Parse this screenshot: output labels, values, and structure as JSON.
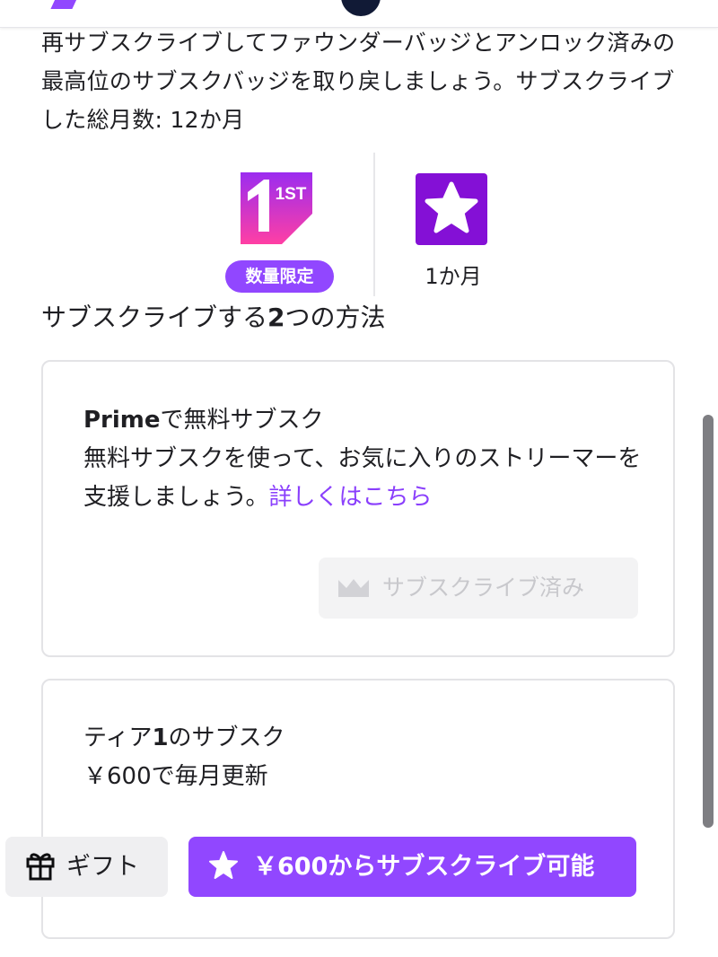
{
  "intro": {
    "text": "再サブスクライブしてファウンダーバッジとアンロック済みの最高位のサブスクバッジを取り戻しましょう。サブスクライブした総月数: 12か月"
  },
  "badges": {
    "first_badge_text": "1ST",
    "limited_label": "数量限定",
    "month_label": "1か月"
  },
  "section_title": {
    "prefix": "サブスクライブする",
    "number": "2",
    "suffix": "つの方法"
  },
  "prime_card": {
    "title_brand": "Prime",
    "title_rest": "で無料サブスク",
    "description": "無料サブスクを使って、お気に入りのストリーマーを支援しましょう。",
    "link": "詳しくはこちら",
    "button_label": "サブスクライブ済み",
    "button_icon": "crown-icon"
  },
  "tier_card": {
    "title_prefix": "ティア",
    "title_number": "1",
    "title_suffix": "のサブスク",
    "price_line": "￥600で毎月更新"
  },
  "actions": {
    "gift_label": "ギフト",
    "gift_icon": "gift-icon",
    "subscribe_label": "￥600からサブスクライブ可能",
    "subscribe_icon": "star-icon"
  },
  "colors": {
    "accent": "#9147ff",
    "link": "#8a3ffc",
    "first_badge_gradient": [
      "#9b2cf0",
      "#ff3fa4"
    ]
  }
}
